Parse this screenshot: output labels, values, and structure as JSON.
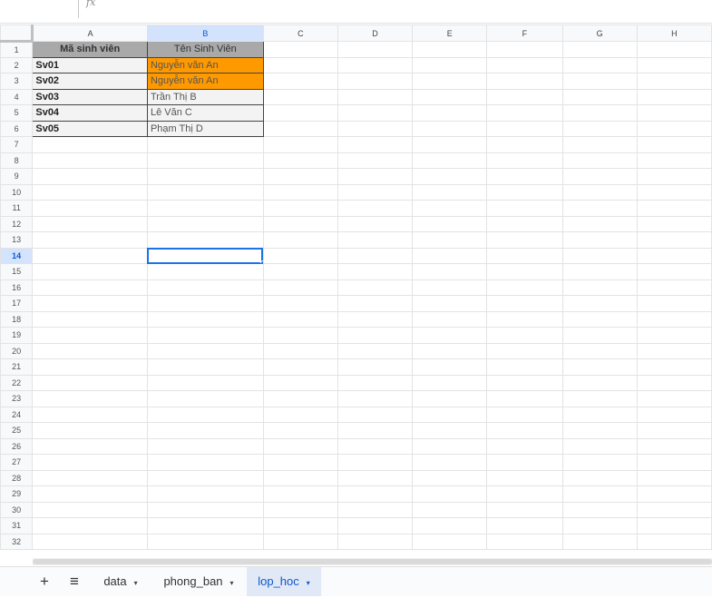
{
  "formula_bar": {
    "fx_label": "fx",
    "value": ""
  },
  "columns": [
    "A",
    "B",
    "C",
    "D",
    "E",
    "F",
    "G",
    "H"
  ],
  "selected_column": "B",
  "selected_row": 14,
  "row_count": 32,
  "rows": [
    [
      "Mã sinh viên",
      "Tên Sinh Viên"
    ],
    [
      "Sv01",
      "Nguyễn văn An"
    ],
    [
      "Sv02",
      "Nguyễn văn An"
    ],
    [
      "Sv03",
      "Trần Thị B"
    ],
    [
      "Sv04",
      "Lê Văn C"
    ],
    [
      "Sv05",
      "Phạm Thị D"
    ]
  ],
  "highlight_color": "#ff9900",
  "sheet_tabs": {
    "add_label": "+",
    "menu_label": "≡",
    "tabs": [
      {
        "label": "data",
        "active": false
      },
      {
        "label": "phong_ban",
        "active": false
      },
      {
        "label": "lop_hoc",
        "active": true
      }
    ],
    "dropdown": "▾"
  }
}
